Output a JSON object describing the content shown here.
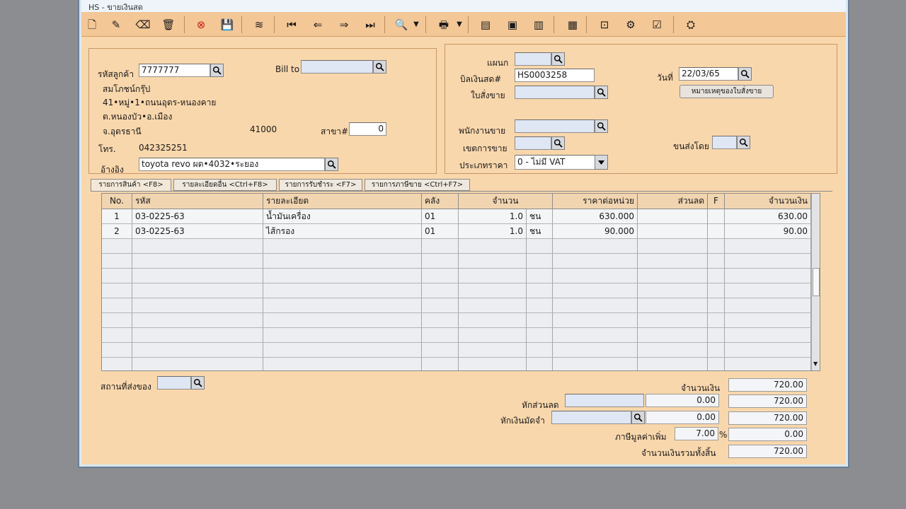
{
  "window": {
    "title": "HS - ขายเงินสด"
  },
  "customer": {
    "code_label": "รหัสลูกค้า",
    "code": "7777777",
    "bill_to_label": "Bill to",
    "bill_to": "",
    "name": "สมโภชน์กรุ๊ป",
    "address_1": "41•หมู่•1•ถนนอุดร-หนองคาย",
    "address_2": "ต.หนองบัว•อ.เมือง",
    "province": "จ.อุดรธานี",
    "postcode": "41000",
    "branch_label": "สาขา#",
    "branch": "0",
    "phone_label": "โทร.",
    "phone": "042325251",
    "reference_label": "อ้างอิง",
    "reference": "toyota revo ผด•4032•ระยอง"
  },
  "doc": {
    "department_label": "แผนก",
    "bill_no_label": "บิลเงินสด#",
    "bill_no": "HS0003258",
    "date_label": "วันที่",
    "date": "22/03/65",
    "sales_order_label": "ใบสั่งขาย",
    "note_button": "หมายเหตุของใบสั่งขาย",
    "salesperson_label": "พนักงานขาย",
    "sales_area_label": "เขตการขาย",
    "shipped_by_label": "ขนส่งโดย",
    "price_type_label": "ประเภทราคา",
    "price_type": "0 - ไม่มี VAT"
  },
  "tabs": [
    {
      "label": "รายการสินค้า <F8>",
      "active": true
    },
    {
      "label": "รายละเอียดอื่น <Ctrl+F8>",
      "active": false
    },
    {
      "label": "รายการรับชำระ <F7>",
      "active": false
    },
    {
      "label": "รายการภาษีขาย <Ctrl+F7>",
      "active": false
    }
  ],
  "grid": {
    "headers": [
      "No.",
      "รหัส",
      "รายละเอียด",
      "คลัง",
      "จำนวน",
      "ราคาต่อหน่วย",
      "ส่วนลด",
      "F",
      "จำนวนเงิน"
    ],
    "rows": [
      {
        "no": "1",
        "code": "03-0225-63",
        "desc": "น้ำมันเครื่อง",
        "wh": "01",
        "qty": "1.0",
        "unit": "ชน",
        "price": "630.000",
        "disc": "",
        "f": "",
        "amount": "630.00"
      },
      {
        "no": "2",
        "code": "03-0225-63",
        "desc": "ไส้กรอง",
        "wh": "01",
        "qty": "1.0",
        "unit": "ชน",
        "price": "90.000",
        "disc": "",
        "f": "",
        "amount": "90.00"
      }
    ]
  },
  "footer": {
    "ship_to_label": "สถานที่ส่งของ",
    "amount_label": "จำนวนเงิน",
    "amount": "720.00",
    "discount_label": "หักส่วนลด",
    "discount": "0.00",
    "after_discount": "720.00",
    "deposit_label": "หักเงินมัดจำ",
    "deposit": "0.00",
    "after_deposit": "720.00",
    "vat_label": "ภาษีมูลค่าเพิ่ม",
    "vat_rate": "7.00",
    "vat_pct": "%",
    "vat_amount": "0.00",
    "grand_total_label": "จำนวนเงินรวมทั้งสิ้น",
    "grand_total": "720.00"
  }
}
